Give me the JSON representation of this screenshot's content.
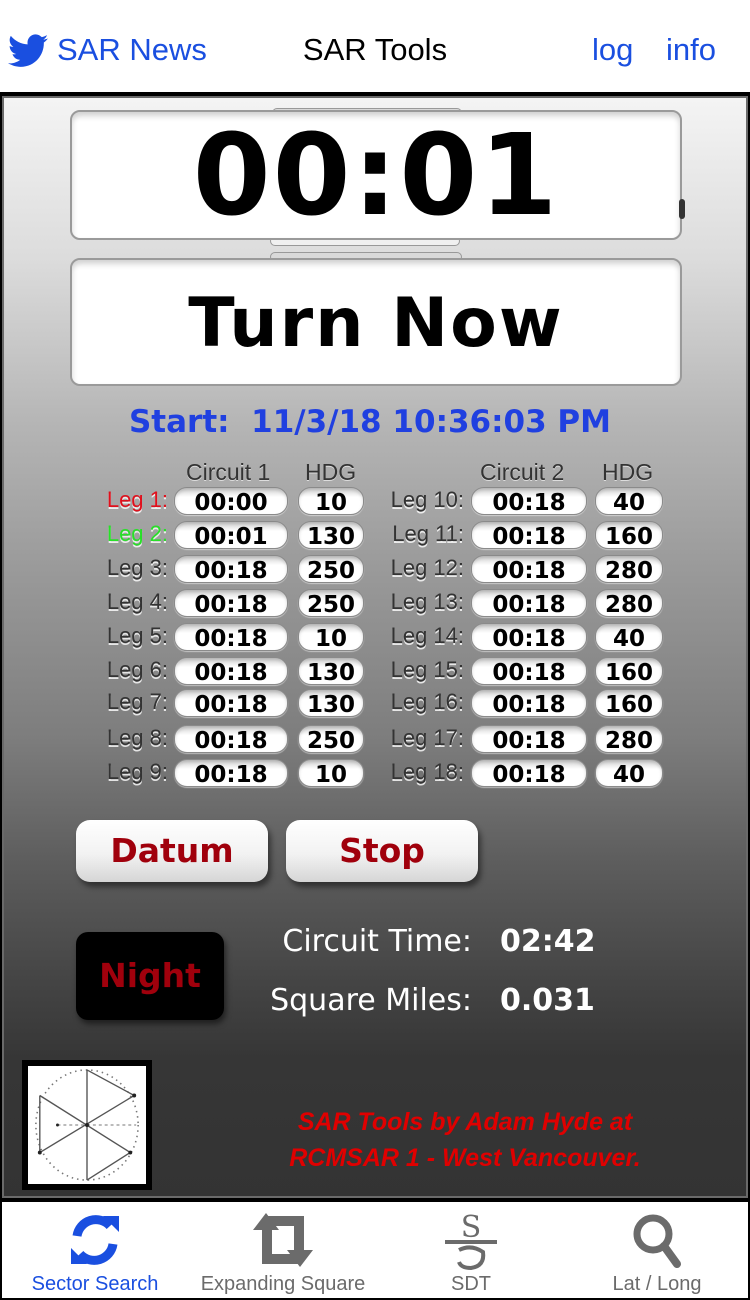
{
  "topbar": {
    "sar_news": "SAR News",
    "title": "SAR Tools",
    "log": "log",
    "info": "info",
    "link_color": "#1a4fe0"
  },
  "timer": {
    "elapsed": "00:01",
    "instruction": "Turn Now"
  },
  "start": {
    "label": "Start:",
    "datetime": "11/3/18 10:36:03 PM",
    "text": "Start:  11/3/18 10:36:03 PM"
  },
  "table": {
    "circuit1_header": "Circuit 1",
    "circuit2_header": "Circuit 2",
    "hdg_header": "HDG",
    "circuit1": [
      {
        "label": "Leg 1:",
        "time": "00:00",
        "hdg": "10",
        "state": "completed"
      },
      {
        "label": "Leg 2:",
        "time": "00:01",
        "hdg": "130",
        "state": "current"
      },
      {
        "label": "Leg 3:",
        "time": "00:18",
        "hdg": "250",
        "state": "pending"
      },
      {
        "label": "Leg 4:",
        "time": "00:18",
        "hdg": "250",
        "state": "pending"
      },
      {
        "label": "Leg 5:",
        "time": "00:18",
        "hdg": "10",
        "state": "pending"
      },
      {
        "label": "Leg 6:",
        "time": "00:18",
        "hdg": "130",
        "state": "pending"
      },
      {
        "label": "Leg 7:",
        "time": "00:18",
        "hdg": "130",
        "state": "pending"
      },
      {
        "label": "Leg 8:",
        "time": "00:18",
        "hdg": "250",
        "state": "pending"
      },
      {
        "label": "Leg 9:",
        "time": "00:18",
        "hdg": "10",
        "state": "pending"
      }
    ],
    "circuit2": [
      {
        "label": "Leg 10:",
        "time": "00:18",
        "hdg": "40",
        "state": "pending"
      },
      {
        "label": "Leg 11:",
        "time": "00:18",
        "hdg": "160",
        "state": "pending"
      },
      {
        "label": "Leg 12:",
        "time": "00:18",
        "hdg": "280",
        "state": "pending"
      },
      {
        "label": "Leg 13:",
        "time": "00:18",
        "hdg": "280",
        "state": "pending"
      },
      {
        "label": "Leg 14:",
        "time": "00:18",
        "hdg": "40",
        "state": "pending"
      },
      {
        "label": "Leg 15:",
        "time": "00:18",
        "hdg": "160",
        "state": "pending"
      },
      {
        "label": "Leg 16:",
        "time": "00:18",
        "hdg": "160",
        "state": "pending"
      },
      {
        "label": "Leg 17:",
        "time": "00:18",
        "hdg": "280",
        "state": "pending"
      },
      {
        "label": "Leg 18:",
        "time": "00:18",
        "hdg": "40",
        "state": "pending"
      }
    ],
    "state_colors": {
      "completed": "#e0101c",
      "current": "#28e028",
      "pending": "#333333"
    }
  },
  "buttons": {
    "datum": "Datum",
    "stop": "Stop",
    "night": "Night"
  },
  "stats": {
    "circuit_time_label": "Circuit Time:",
    "circuit_time": "02:42",
    "square_miles_label": "Square Miles:",
    "square_miles": "0.031"
  },
  "thumbnail": {
    "icon": "sector-search-diagram"
  },
  "credit": {
    "line1": "SAR Tools by Adam Hyde at",
    "line2": "RCMSAR 1 - West Vancouver.",
    "color": "#e00000"
  },
  "tabs": [
    {
      "label": "Sector Search",
      "icon": "refresh-icon",
      "active": true
    },
    {
      "label": "Expanding Square",
      "icon": "retweet-icon",
      "active": false
    },
    {
      "label": "SDT",
      "icon": "sdt-icon",
      "active": false
    },
    {
      "label": "Lat / Long",
      "icon": "search-icon",
      "active": false
    }
  ],
  "colors": {
    "accent": "#1a4fe0",
    "button_text": "#a0000c",
    "start_text": "#2040e0"
  }
}
